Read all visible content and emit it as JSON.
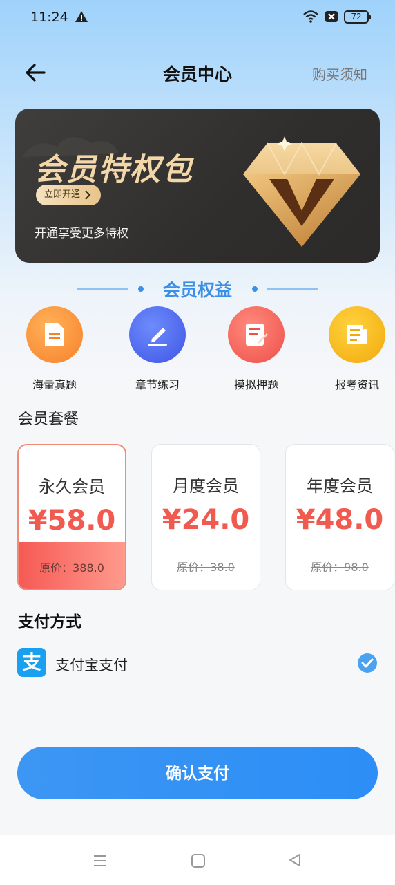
{
  "status_bar": {
    "time": "11:24",
    "battery": "72"
  },
  "header": {
    "title": "会员中心",
    "notice_link": "购买须知"
  },
  "banner": {
    "title": "会员特权包",
    "cta": "立即开通",
    "subtitle": "开通享受更多特权"
  },
  "benefits": {
    "title": "会员权益",
    "items": [
      {
        "label": "海量真题",
        "icon": "document-icon",
        "color": "#f98a2b"
      },
      {
        "label": "章节练习",
        "icon": "pen-icon",
        "color": "#4c6df0"
      },
      {
        "label": "摸拟押题",
        "icon": "exam-sheet-icon",
        "color": "#f2605a"
      },
      {
        "label": "报考资讯",
        "icon": "news-icon",
        "color": "#f6b612"
      }
    ]
  },
  "plans": {
    "title": "会员套餐",
    "items": [
      {
        "name": "永久会员",
        "price": "¥58.0",
        "original": "原价：388.0",
        "selected": true
      },
      {
        "name": "月度会员",
        "price": "¥24.0",
        "original": "原价：38.0",
        "selected": false
      },
      {
        "name": "年度会员",
        "price": "¥48.0",
        "original": "原价：98.0",
        "selected": false
      }
    ]
  },
  "payment": {
    "title": "支付方式",
    "method": "支付宝支付",
    "method_icon_text": "支"
  },
  "confirm_button": "确认支付"
}
